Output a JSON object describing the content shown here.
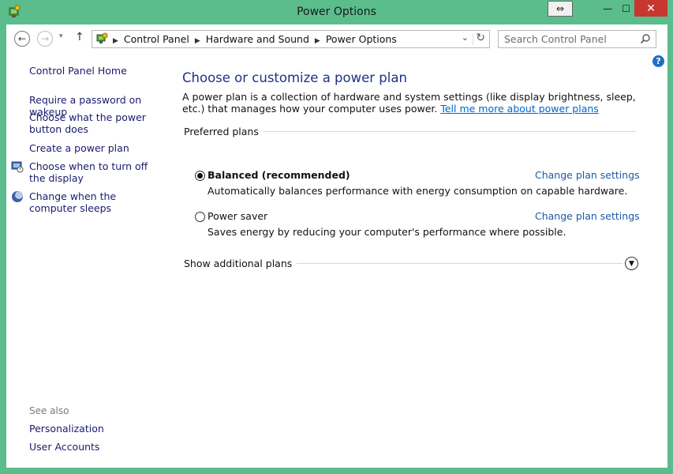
{
  "window": {
    "title": "Power Options",
    "close_glyph": "✕",
    "min_glyph": "—",
    "max_glyph": "☐",
    "snap_glyph": "⇔"
  },
  "navigation": {
    "back_glyph": "←",
    "forward_glyph": "→",
    "recent_glyph": "▾",
    "up_glyph": "↑",
    "breadcrumbs": [
      "Control Panel",
      "Hardware and Sound",
      "Power Options"
    ],
    "search_placeholder": "Search Control Panel"
  },
  "sidebar": {
    "home": "Control Panel Home",
    "links": [
      "Require a password on wakeup",
      "Choose what the power button does",
      "Create a power plan",
      "Choose when to turn off the display",
      "Change when the computer sleeps"
    ],
    "see_also_label": "See also",
    "see_also": [
      "Personalization",
      "User Accounts"
    ]
  },
  "main": {
    "title": "Choose or customize a power plan",
    "description": "A power plan is a collection of hardware and system settings (like display brightness, sleep, etc.) that manages how your computer uses power.",
    "learn_more": "Tell me more about power plans",
    "preferred_label": "Preferred plans",
    "plans": [
      {
        "name": "Balanced (recommended)",
        "description": "Automatically balances performance with energy consumption on capable hardware.",
        "link": "Change plan settings",
        "selected": true
      },
      {
        "name": "Power saver",
        "description": "Saves energy by reducing your computer's performance where possible.",
        "link": "Change plan settings",
        "selected": false
      }
    ],
    "additional_label": "Show additional plans"
  },
  "colors": {
    "frame": "#5bbd8c",
    "title_blue": "#1e3287",
    "link_blue": "#1a5aa8",
    "close_red": "#c7372f"
  },
  "help_glyph": "?"
}
